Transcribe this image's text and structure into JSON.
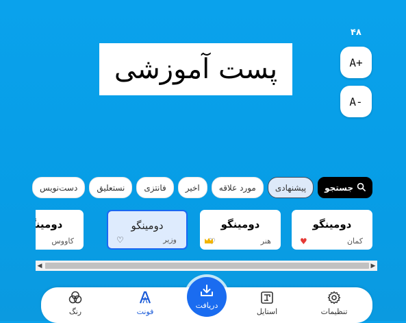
{
  "size_readout": "۴۸",
  "zoom": {
    "in_label": "A+",
    "out_label": "A-"
  },
  "preview": {
    "text": "پست آموزشی"
  },
  "chips": {
    "search_label": "جستجو",
    "items": [
      {
        "label": "پیشنهادی",
        "active": true
      },
      {
        "label": "مورد علاقه",
        "active": false
      },
      {
        "label": "اخیر",
        "active": false
      },
      {
        "label": "فانتزی",
        "active": false
      },
      {
        "label": "نستعلیق",
        "active": false
      },
      {
        "label": "دست‌نویس",
        "active": false
      }
    ]
  },
  "font_cards": [
    {
      "sample": "دومینگو",
      "name": "کمان",
      "favorite": true,
      "premium": false,
      "selected": false
    },
    {
      "sample": "دومینگو",
      "name": "هنر",
      "favorite": false,
      "premium": true,
      "selected": false
    },
    {
      "sample": "دومینگو",
      "name": "وزیر",
      "favorite": false,
      "premium": false,
      "selected": true
    },
    {
      "sample": "دومینگو",
      "name": "کاووس",
      "favorite": false,
      "premium": false,
      "selected": false
    }
  ],
  "bottom_nav": {
    "settings_label": "تنظیمات",
    "style_label": "استایل",
    "download_label": "دریافت",
    "font_label": "فونت",
    "color_label": "رنگ",
    "active": "font"
  },
  "colors": {
    "background": "#0aa2ec",
    "accent": "#1a6cf0",
    "selected_card": "#deebfd",
    "favorite": "#e53935",
    "premium": "#f2b400"
  }
}
